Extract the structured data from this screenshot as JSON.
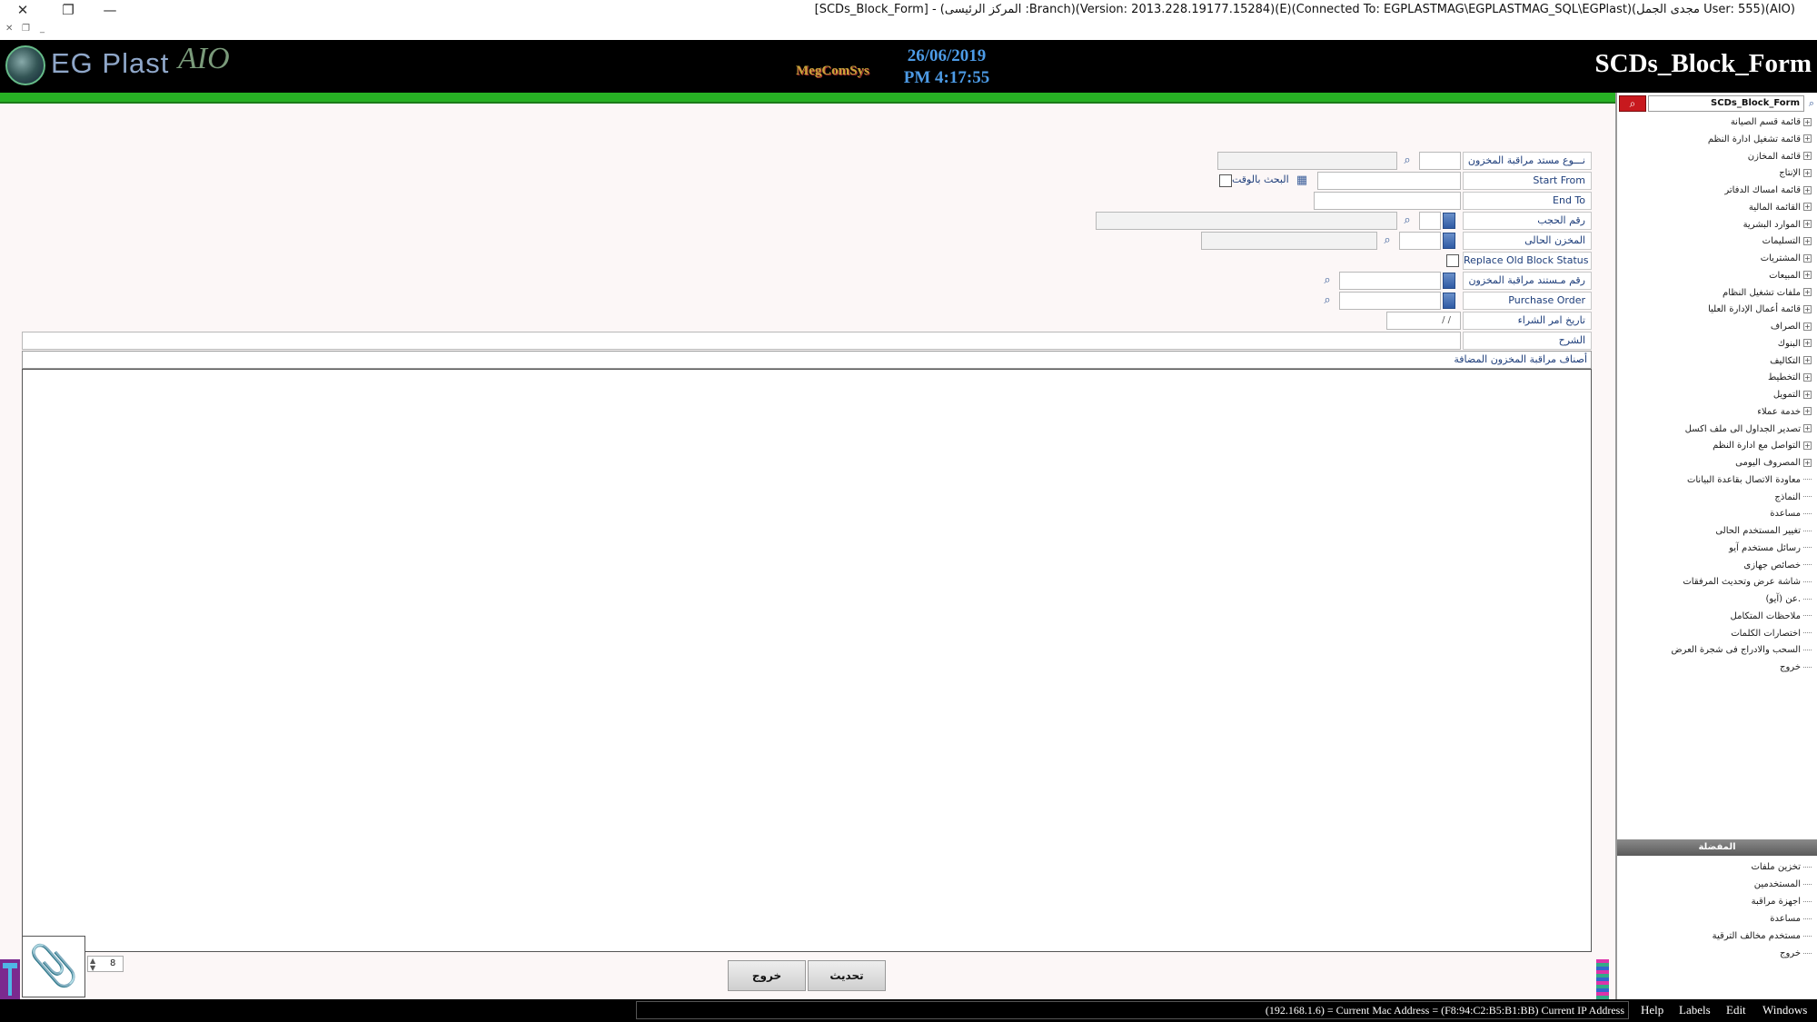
{
  "window": {
    "title": "[SCDs_Block_Form] - (المركز الرئيسى :Branch)(Version: 2013.228.19177.15284)(E)(Connected To: EGPLASTMAG\\EGPLASTMAG_SQL\\EGPlast)(مجدى الجمل User: 555)(AIO)",
    "close_glyph": "✕",
    "restore_glyph": "❐",
    "minimize_glyph": "—"
  },
  "header": {
    "logo_text": "EG Plast",
    "logo_suffix": "AIO",
    "brand_mark": "MegComSys",
    "date": "26/06/2019",
    "time": "PM 4:17:55",
    "form_title": "SCDs_Block_Form"
  },
  "form": {
    "doc_type_label": "نـــوع مستد مراقبة المخزون",
    "start_from_label": "Start From",
    "time_search_label": "البحث بالوقت",
    "end_to_label": "End To",
    "reservation_no_label": "رقم الحجب",
    "current_store_label": "المخزن الحالى",
    "replace_old_label": "Replace Old Block Status",
    "control_doc_no_label": "رقم مـستند مراقبة المخزون",
    "purchase_order_label": "Purchase Order",
    "po_date_label": "تاريخ امر الشراء",
    "po_date_value": "/ /",
    "notes_label": "الشرح",
    "items_header": "أصناف مراقبة المخزون المضافة"
  },
  "bottom": {
    "update_button": "تحديث",
    "exit_button": "خروج",
    "page_value": "8",
    "attach_icon": "📎"
  },
  "status_bar": {
    "text": "(192.168.1.6) = Current Mac Address = (F8:94:C2:B5:B1:BB) Current IP Address",
    "menu": [
      "Help",
      "Labels",
      "Edit",
      "Windows"
    ]
  },
  "sidebar": {
    "search_value": "SCDs_Block_Form",
    "tree": [
      {
        "label": "قائمة قسم الصيانة",
        "expandable": true
      },
      {
        "label": "قائمة تشغيل ادارة النظم",
        "expandable": true
      },
      {
        "label": "قائمة المخازن",
        "expandable": true
      },
      {
        "label": "الإنتاج",
        "expandable": true
      },
      {
        "label": "قائمة امساك الدفاتر",
        "expandable": true
      },
      {
        "label": "القائمة المالية",
        "expandable": true
      },
      {
        "label": "الموارد البشرية",
        "expandable": true
      },
      {
        "label": "التسليمات",
        "expandable": true
      },
      {
        "label": "المشتريات",
        "expandable": true
      },
      {
        "label": "المبيعات",
        "expandable": true
      },
      {
        "label": "ملفات تشغيل النظام",
        "expandable": true
      },
      {
        "label": "قائمة أعمال الإدارة العليا",
        "expandable": true
      },
      {
        "label": "الصراف",
        "expandable": true
      },
      {
        "label": "البنوك",
        "expandable": true
      },
      {
        "label": "التكاليف",
        "expandable": true
      },
      {
        "label": "التخطيط",
        "expandable": true
      },
      {
        "label": "التمويل",
        "expandable": true
      },
      {
        "label": "خدمة عملاء",
        "expandable": true
      },
      {
        "label": "تصدير الجداول الى ملف اكسل",
        "expandable": true
      },
      {
        "label": "التواصل مع ادارة النظم",
        "expandable": true
      },
      {
        "label": "المصروف اليومى",
        "expandable": true
      },
      {
        "label": "معاودة الاتصال بقاعدة البيانات",
        "expandable": false
      },
      {
        "label": "النماذج",
        "expandable": false
      },
      {
        "label": "مساعدة",
        "expandable": false
      },
      {
        "label": "تغيير المستخدم الحالى",
        "expandable": false
      },
      {
        "label": "رسائل مستخدم آيو",
        "expandable": false
      },
      {
        "label": "خصائص جهازى",
        "expandable": false
      },
      {
        "label": "شاشة عرض وتحديث المرفقات",
        "expandable": false
      },
      {
        "label": "عن (آيو).",
        "expandable": false
      },
      {
        "label": "ملاحظات المتكامل",
        "expandable": false
      },
      {
        "label": "اختصارات الكلمات",
        "expandable": false
      },
      {
        "label": "السحب والادراج فى شجرة العرض",
        "expandable": false
      },
      {
        "label": "خروج",
        "expandable": false
      }
    ],
    "favorites_header": "المفضلة",
    "favorites": [
      {
        "label": "تخزين ملفات"
      },
      {
        "label": "المستخدمين"
      },
      {
        "label": "اجهزة مراقبة"
      },
      {
        "label": "مساعدة"
      },
      {
        "label": "مستخدم مخالف الترقية"
      },
      {
        "label": "خروج"
      }
    ]
  },
  "colors": {
    "header_bg": "#000000",
    "accent_green": "#27b024",
    "clock_blue": "#4d9be6",
    "label_blue": "#1d3d7a",
    "search_red": "#c8191e"
  }
}
